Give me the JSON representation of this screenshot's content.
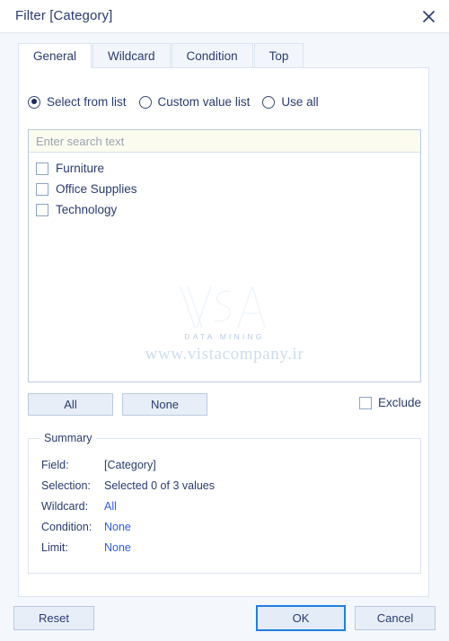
{
  "titlebar": {
    "title": "Filter [Category]",
    "close_icon": "close-icon"
  },
  "tabs": [
    {
      "label": "General",
      "active": true
    },
    {
      "label": "Wildcard",
      "active": false
    },
    {
      "label": "Condition",
      "active": false
    },
    {
      "label": "Top",
      "active": false
    }
  ],
  "mode_options": [
    {
      "label": "Select from list",
      "selected": true
    },
    {
      "label": "Custom value list",
      "selected": false
    },
    {
      "label": "Use all",
      "selected": false
    }
  ],
  "search": {
    "value": "",
    "placeholder": "Enter search text"
  },
  "list_items": [
    {
      "label": "Furniture",
      "checked": false
    },
    {
      "label": "Office Supplies",
      "checked": false
    },
    {
      "label": "Technology",
      "checked": false
    }
  ],
  "watermark": {
    "brand": "VSA",
    "tagline": "DATA MINING",
    "url": "www.vistacompany.ir"
  },
  "selection_buttons": {
    "all_label": "All",
    "none_label": "None"
  },
  "exclude": {
    "label": "Exclude",
    "checked": false
  },
  "summary": {
    "legend": "Summary",
    "rows": [
      {
        "key": "Field:",
        "value": "[Category]",
        "link": false
      },
      {
        "key": "Selection:",
        "value": "Selected 0 of 3 values",
        "link": false
      },
      {
        "key": "Wildcard:",
        "value": "All",
        "link": true
      },
      {
        "key": "Condition:",
        "value": "None",
        "link": true
      },
      {
        "key": "Limit:",
        "value": "None",
        "link": true
      }
    ]
  },
  "footer": {
    "reset_label": "Reset",
    "ok_label": "OK",
    "cancel_label": "Cancel"
  },
  "colors": {
    "accent": "#2f5bff",
    "focus_border": "#1f7fe0",
    "text": "#2a3b72",
    "search_bg": "#fbfbef"
  }
}
